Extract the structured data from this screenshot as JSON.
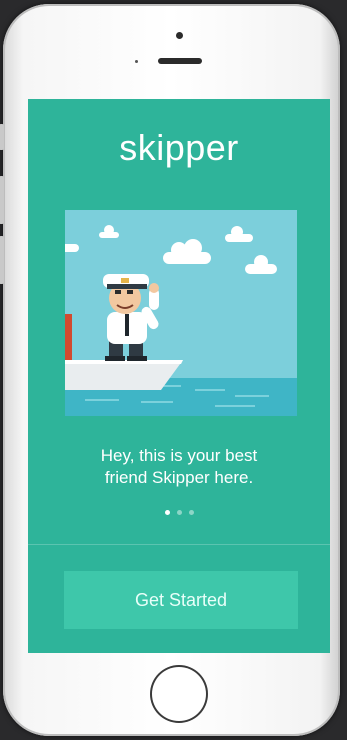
{
  "app": {
    "brand": "skipper"
  },
  "onboarding": {
    "caption_line1": "Hey, this is your best",
    "caption_line2": "friend Skipper here.",
    "page_count": 3,
    "active_page": 1
  },
  "actions": {
    "get_started_label": "Get Started"
  },
  "illustration": {
    "icon": "sailor-on-boat-illustration"
  },
  "colors": {
    "screen_bg": "#2eb49a",
    "button_bg": "#3ec7aa",
    "sky": "#7ccfdb",
    "sea": "#3fb5c6"
  }
}
